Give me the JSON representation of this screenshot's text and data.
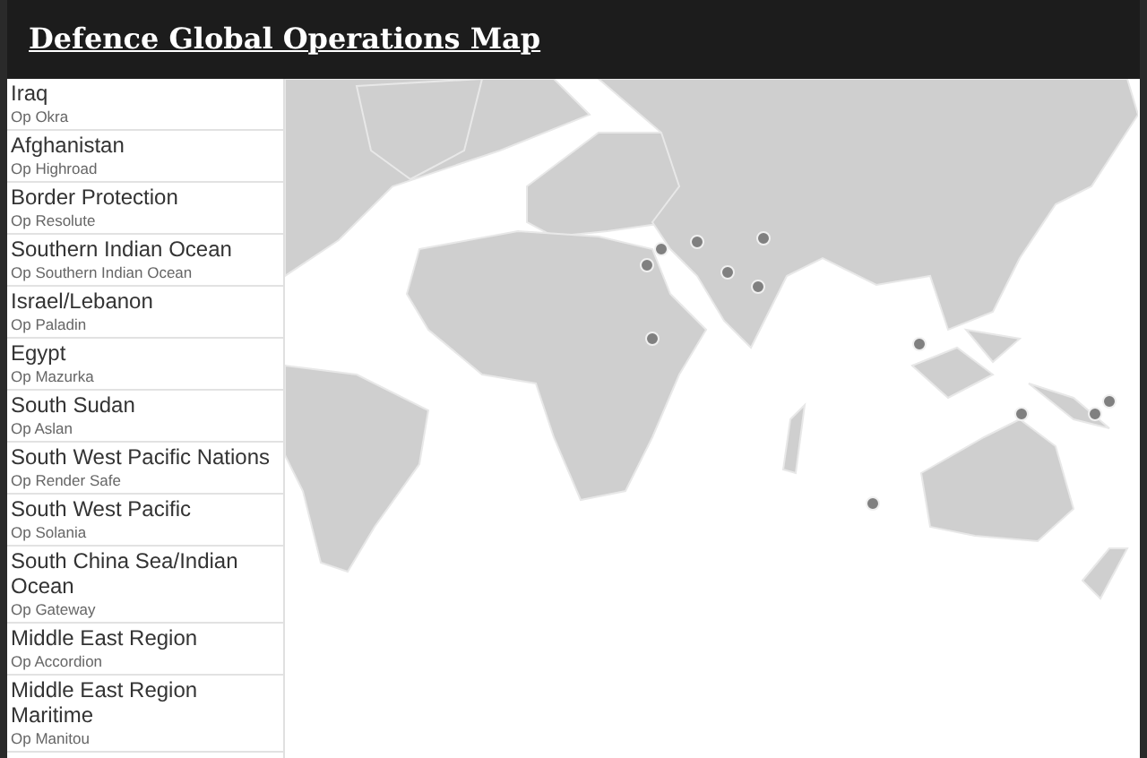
{
  "header": {
    "title": "Defence Global Operations Map"
  },
  "operations": [
    {
      "region": "Iraq",
      "operation": "Op Okra"
    },
    {
      "region": "Afghanistan",
      "operation": "Op Highroad"
    },
    {
      "region": "Border Protection",
      "operation": "Op Resolute"
    },
    {
      "region": "Southern Indian Ocean",
      "operation": "Op Southern Indian Ocean"
    },
    {
      "region": "Israel/Lebanon",
      "operation": "Op Paladin"
    },
    {
      "region": "Egypt",
      "operation": "Op Mazurka"
    },
    {
      "region": "South Sudan",
      "operation": "Op Aslan"
    },
    {
      "region": "South West Pacific Nations",
      "operation": "Op Render Safe"
    },
    {
      "region": "South West Pacific",
      "operation": "Op Solania"
    },
    {
      "region": "South China Sea/Indian Ocean",
      "operation": "Op Gateway"
    },
    {
      "region": "Middle East Region",
      "operation": "Op Accordion"
    },
    {
      "region": "Middle East Region Maritime",
      "operation": "Op Manitou"
    }
  ]
}
